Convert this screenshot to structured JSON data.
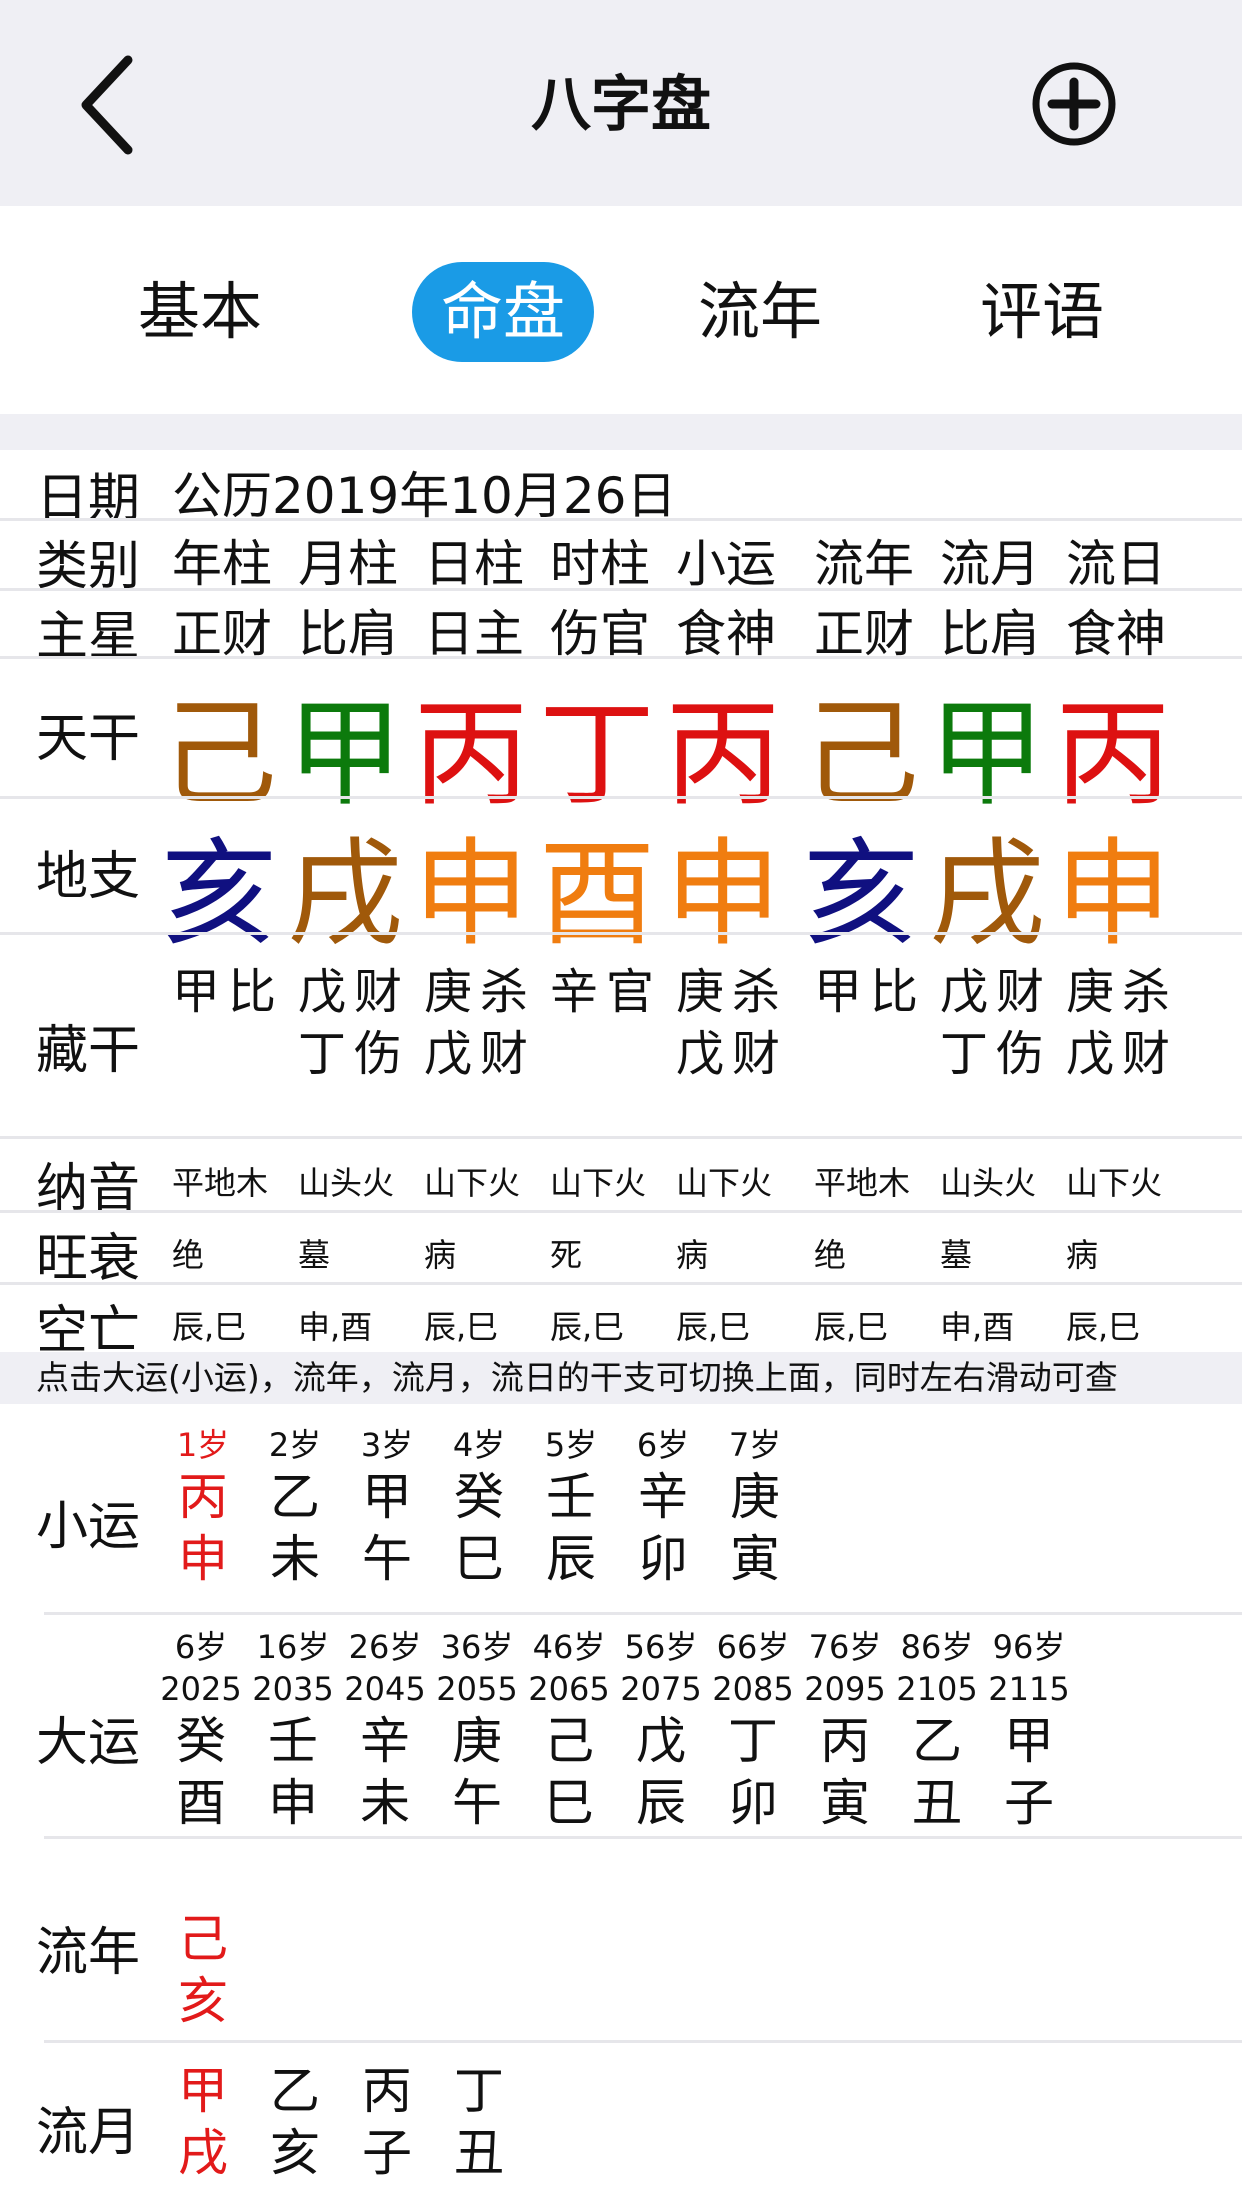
{
  "nav": {
    "title": "八字盘"
  },
  "tabs": [
    {
      "label": "基本",
      "active": false
    },
    {
      "label": "命盘",
      "active": true
    },
    {
      "label": "流年",
      "active": false
    },
    {
      "label": "评语",
      "active": false
    }
  ],
  "table": {
    "date_label": "日期",
    "date_value": "公历2019年10月26日",
    "category_label": "类别",
    "categories": [
      "年柱",
      "月柱",
      "日柱",
      "时柱",
      "小运",
      "流年",
      "流月",
      "流日"
    ],
    "main_star_label": "主星",
    "main_stars": [
      "正财",
      "比肩",
      "日主",
      "伤官",
      "食神",
      "正财",
      "比肩",
      "食神"
    ],
    "tiangan_label": "天干",
    "tiangan": [
      {
        "char": "己",
        "color": "#a0590a"
      },
      {
        "char": "甲",
        "color": "#0c7a0c"
      },
      {
        "char": "丙",
        "color": "#dd1111"
      },
      {
        "char": "丁",
        "color": "#dd1111"
      },
      {
        "char": "丙",
        "color": "#dd1111"
      },
      {
        "char": "己",
        "color": "#a0590a"
      },
      {
        "char": "甲",
        "color": "#0c7a0c"
      },
      {
        "char": "丙",
        "color": "#dd1111"
      }
    ],
    "dizhi_label": "地支",
    "dizhi": [
      {
        "char": "亥",
        "color": "#101080"
      },
      {
        "char": "戌",
        "color": "#a0590a"
      },
      {
        "char": "申",
        "color": "#f07d10"
      },
      {
        "char": "酉",
        "color": "#f07d10"
      },
      {
        "char": "申",
        "color": "#f07d10"
      },
      {
        "char": "亥",
        "color": "#101080"
      },
      {
        "char": "戌",
        "color": "#a0590a"
      },
      {
        "char": "申",
        "color": "#f07d10"
      }
    ],
    "canggan_label": "藏干",
    "canggan": [
      [
        "甲比"
      ],
      [
        "戊财",
        "丁伤"
      ],
      [
        "庚杀",
        "戊财"
      ],
      [
        "辛官"
      ],
      [
        "庚杀",
        "戊财"
      ],
      [
        "甲比"
      ],
      [
        "戊财",
        "丁伤"
      ],
      [
        "庚杀",
        "戊财"
      ]
    ],
    "nayin_label": "纳音",
    "nayin": [
      "平地木",
      "山头火",
      "山下火",
      "山下火",
      "山下火",
      "平地木",
      "山头火",
      "山下火"
    ],
    "wangshuai_label": "旺衰",
    "wangshuai": [
      "绝",
      "墓",
      "病",
      "死",
      "病",
      "绝",
      "墓",
      "病"
    ],
    "kongwang_label": "空亡",
    "kongwang": [
      "辰,巳",
      "申,酉",
      "辰,巳",
      "辰,巳",
      "辰,巳",
      "辰,巳",
      "申,酉",
      "辰,巳"
    ]
  },
  "hint": "点击大运(小运)，流年，流月，流日的干支可切换上面，同时左右滑动可查",
  "xiaoyun": {
    "label": "小运",
    "items": [
      {
        "age": "1岁",
        "gan": "丙",
        "zhi": "申",
        "highlight": true
      },
      {
        "age": "2岁",
        "gan": "乙",
        "zhi": "未",
        "highlight": false
      },
      {
        "age": "3岁",
        "gan": "甲",
        "zhi": "午",
        "highlight": false
      },
      {
        "age": "4岁",
        "gan": "癸",
        "zhi": "巳",
        "highlight": false
      },
      {
        "age": "5岁",
        "gan": "壬",
        "zhi": "辰",
        "highlight": false
      },
      {
        "age": "6岁",
        "gan": "辛",
        "zhi": "卯",
        "highlight": false
      },
      {
        "age": "7岁",
        "gan": "庚",
        "zhi": "寅",
        "highlight": false
      }
    ]
  },
  "dayun": {
    "label": "大运",
    "items": [
      {
        "age": "6岁",
        "year": "2025",
        "gan": "癸",
        "zhi": "酉"
      },
      {
        "age": "16岁",
        "year": "2035",
        "gan": "壬",
        "zhi": "申"
      },
      {
        "age": "26岁",
        "year": "2045",
        "gan": "辛",
        "zhi": "未"
      },
      {
        "age": "36岁",
        "year": "2055",
        "gan": "庚",
        "zhi": "午"
      },
      {
        "age": "46岁",
        "year": "2065",
        "gan": "己",
        "zhi": "巳"
      },
      {
        "age": "56岁",
        "year": "2075",
        "gan": "戊",
        "zhi": "辰"
      },
      {
        "age": "66岁",
        "year": "2085",
        "gan": "丁",
        "zhi": "卯"
      },
      {
        "age": "76岁",
        "year": "2095",
        "gan": "丙",
        "zhi": "寅"
      },
      {
        "age": "86岁",
        "year": "2105",
        "gan": "乙",
        "zhi": "丑"
      },
      {
        "age": "96岁",
        "year": "2115",
        "gan": "甲",
        "zhi": "子"
      }
    ]
  },
  "liunian": {
    "label": "流年",
    "items": [
      {
        "gan": "己",
        "zhi": "亥",
        "highlight": true
      }
    ]
  },
  "liuyue": {
    "label": "流月",
    "items": [
      {
        "gan": "甲",
        "zhi": "戌",
        "highlight": true
      },
      {
        "gan": "乙",
        "zhi": "亥",
        "highlight": false
      },
      {
        "gan": "丙",
        "zhi": "子",
        "highlight": false
      },
      {
        "gan": "丁",
        "zhi": "丑",
        "highlight": false
      }
    ]
  }
}
